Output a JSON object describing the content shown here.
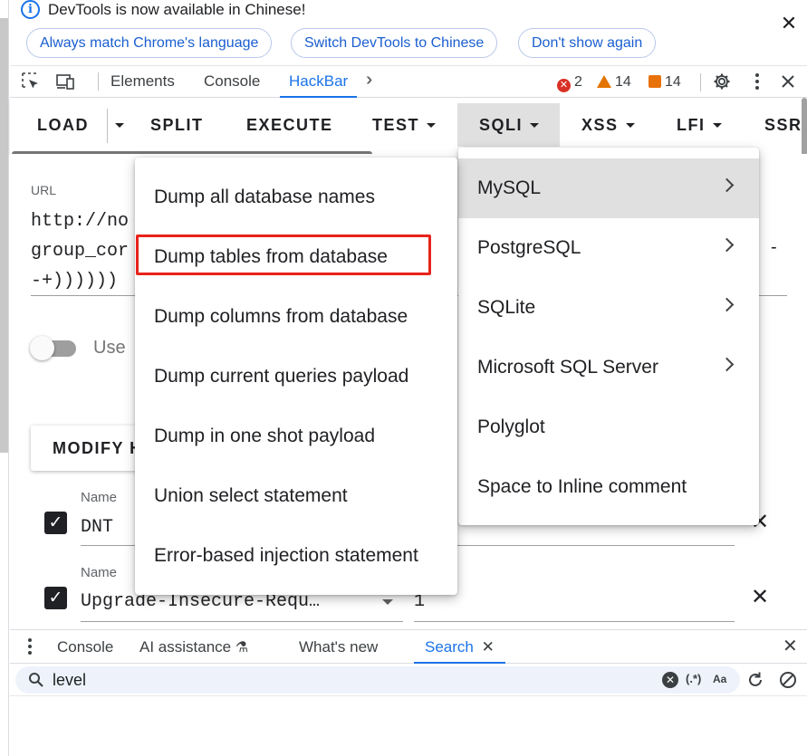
{
  "infobar": {
    "message": "DevTools is now available in Chinese!",
    "buttons": [
      "Always match Chrome's language",
      "Switch DevTools to Chinese",
      "Don't show again"
    ]
  },
  "tabs": {
    "items": [
      "Elements",
      "Console",
      "HackBar"
    ],
    "active": "HackBar",
    "errors": "2",
    "warnings": "14",
    "issues": "14"
  },
  "hackbar": {
    "buttons": [
      "LOAD",
      "SPLIT",
      "EXECUTE",
      "TEST",
      "SQLI",
      "XSS",
      "LFI",
      "SSRF"
    ],
    "url_label": "URL",
    "url_lines": [
      "http://no",
      "group_cor",
      "-+))))))"
    ],
    "url_dash": "-",
    "toggle_label": "Use",
    "modify_label": "MODIFY H",
    "headers": [
      {
        "label": "Name",
        "value": "DNT"
      },
      {
        "label": "Name",
        "value": "Upgrade-Insecure-Requ…",
        "value2": "1"
      }
    ]
  },
  "sqli_menu": {
    "items": [
      "Dump all database names",
      "Dump tables from database",
      "Dump columns from database",
      "Dump current queries payload",
      "Dump in one shot payload",
      "Union select statement",
      "Error-based injection statement"
    ],
    "highlighted_boxed": "Dump tables from database"
  },
  "db_menu": {
    "items": [
      "MySQL",
      "PostgreSQL",
      "SQLite",
      "Microsoft SQL Server",
      "Polyglot",
      "Space to Inline comment"
    ],
    "submenu_items": [
      "MySQL",
      "PostgreSQL",
      "SQLite",
      "Microsoft SQL Server"
    ],
    "selected": "MySQL"
  },
  "drawer": {
    "tabs": [
      "Console",
      "AI assistance",
      "What's new",
      "Search"
    ],
    "active": "Search",
    "search_value": "level",
    "regex_label": "(.*)",
    "case_label": "Aa"
  },
  "colors": {
    "accent": "#1a73e8",
    "error": "#d93025",
    "warning": "#e37400",
    "highlight_box": "#e8231b"
  }
}
